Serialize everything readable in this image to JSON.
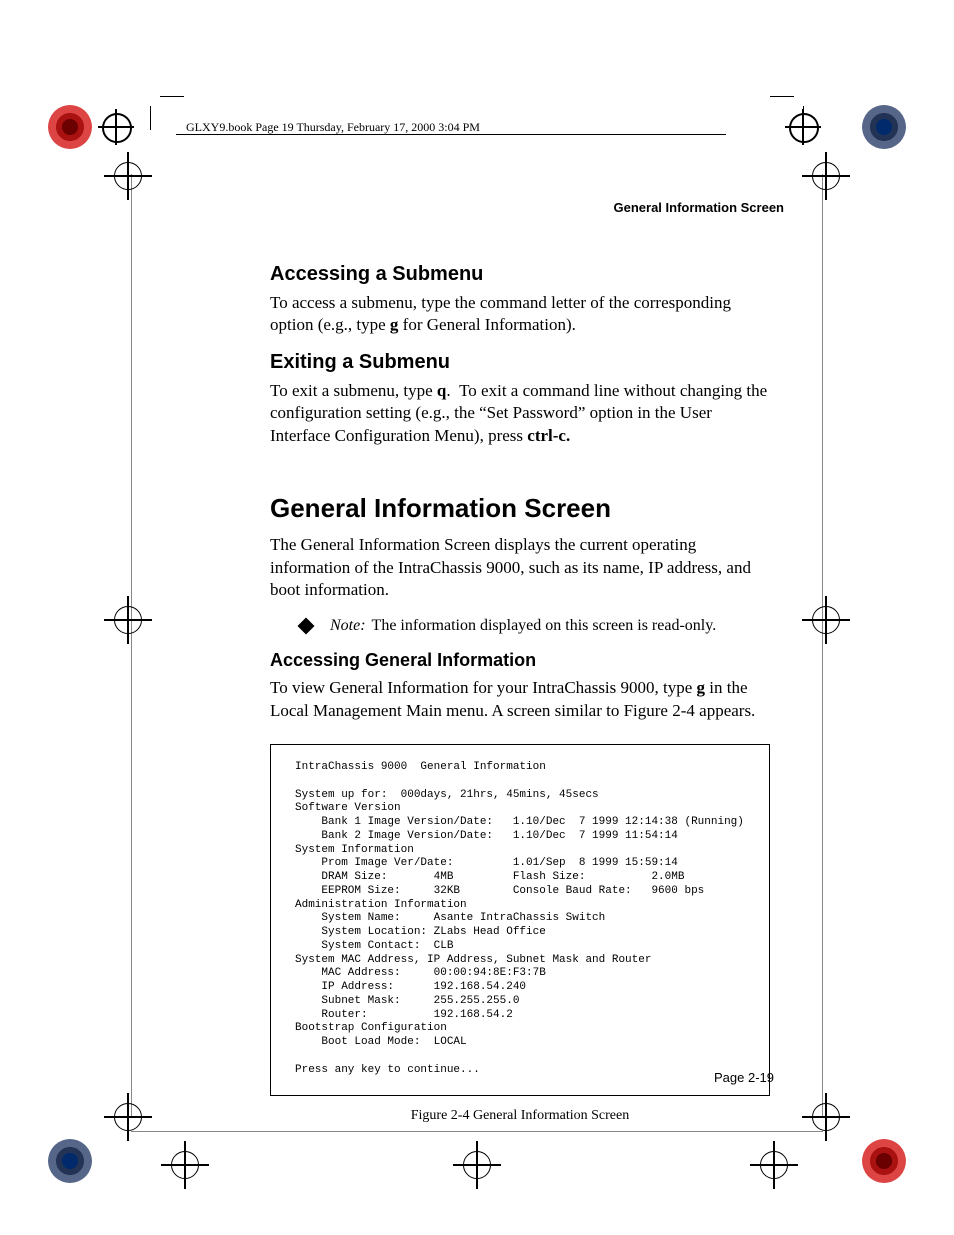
{
  "header_line": "GLXY9.book  Page 19  Thursday, February 17, 2000  3:04 PM",
  "running_head": "General Information Screen",
  "sec_access_sub": {
    "heading": "Accessing a Submenu",
    "body": "To access a submenu, type the command letter of the corresponding option (e.g., type g for General Information)."
  },
  "sec_exit_sub": {
    "heading": "Exiting a Submenu",
    "body": "To exit a submenu, type q.   To exit a command line without changing the configuration setting (e.g., the “Set Password” option in the User Interface Configuration Menu), press ctrl-c."
  },
  "sec_general": {
    "heading": "General Information Screen",
    "body": "The General Information Screen displays the current operating information of the IntraChassis 9000, such as its name, IP address, and boot information.",
    "note_label": "Note:",
    "note_text": "The information displayed on this screen is read-only."
  },
  "sec_access_gen": {
    "heading": "Accessing General Information",
    "body": "To view General Information for your IntraChassis 9000, type g in the Local Management Main menu. A screen similar to Figure 2-4 appears."
  },
  "terminal": "IntraChassis 9000  General Information\n\nSystem up for:  000days, 21hrs, 45mins, 45secs\nSoftware Version\n    Bank 1 Image Version/Date:   1.10/Dec  7 1999 12:14:38 (Running)\n    Bank 2 Image Version/Date:   1.10/Dec  7 1999 11:54:14\nSystem Information\n    Prom Image Ver/Date:         1.01/Sep  8 1999 15:59:14\n    DRAM Size:       4MB         Flash Size:          2.0MB\n    EEPROM Size:     32KB        Console Baud Rate:   9600 bps\nAdministration Information\n    System Name:     Asante IntraChassis Switch\n    System Location: ZLabs Head Office\n    System Contact:  CLB\nSystem MAC Address, IP Address, Subnet Mask and Router\n    MAC Address:     00:00:94:8E:F3:7B\n    IP Address:      192.168.54.240\n    Subnet Mask:     255.255.255.0\n    Router:          192.168.54.2\nBootstrap Configuration\n    Boot Load Mode:  LOCAL\n\nPress any key to continue...",
  "figure_caption": "Figure 2-4   General Information Screen",
  "page_number": "Page 2-19"
}
